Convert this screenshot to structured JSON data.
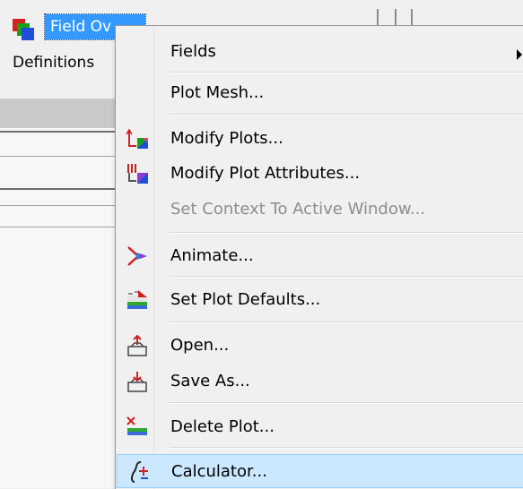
{
  "header": {
    "title_field": "Field Ov",
    "definitions_label": "Definitions"
  },
  "menu": {
    "fields": "Fields",
    "plot_mesh": "Plot Mesh...",
    "modify_plots": "Modify Plots...",
    "modify_plot_attributes": "Modify Plot Attributes...",
    "set_context": "Set Context To Active Window...",
    "animate": "Animate...",
    "set_plot_defaults": "Set Plot Defaults...",
    "open": "Open...",
    "save_as": "Save As...",
    "delete_plot": "Delete Plot...",
    "calculator": "Calculator..."
  },
  "colors": {
    "selection": "#3399ff",
    "highlight": "#cce8ff"
  }
}
